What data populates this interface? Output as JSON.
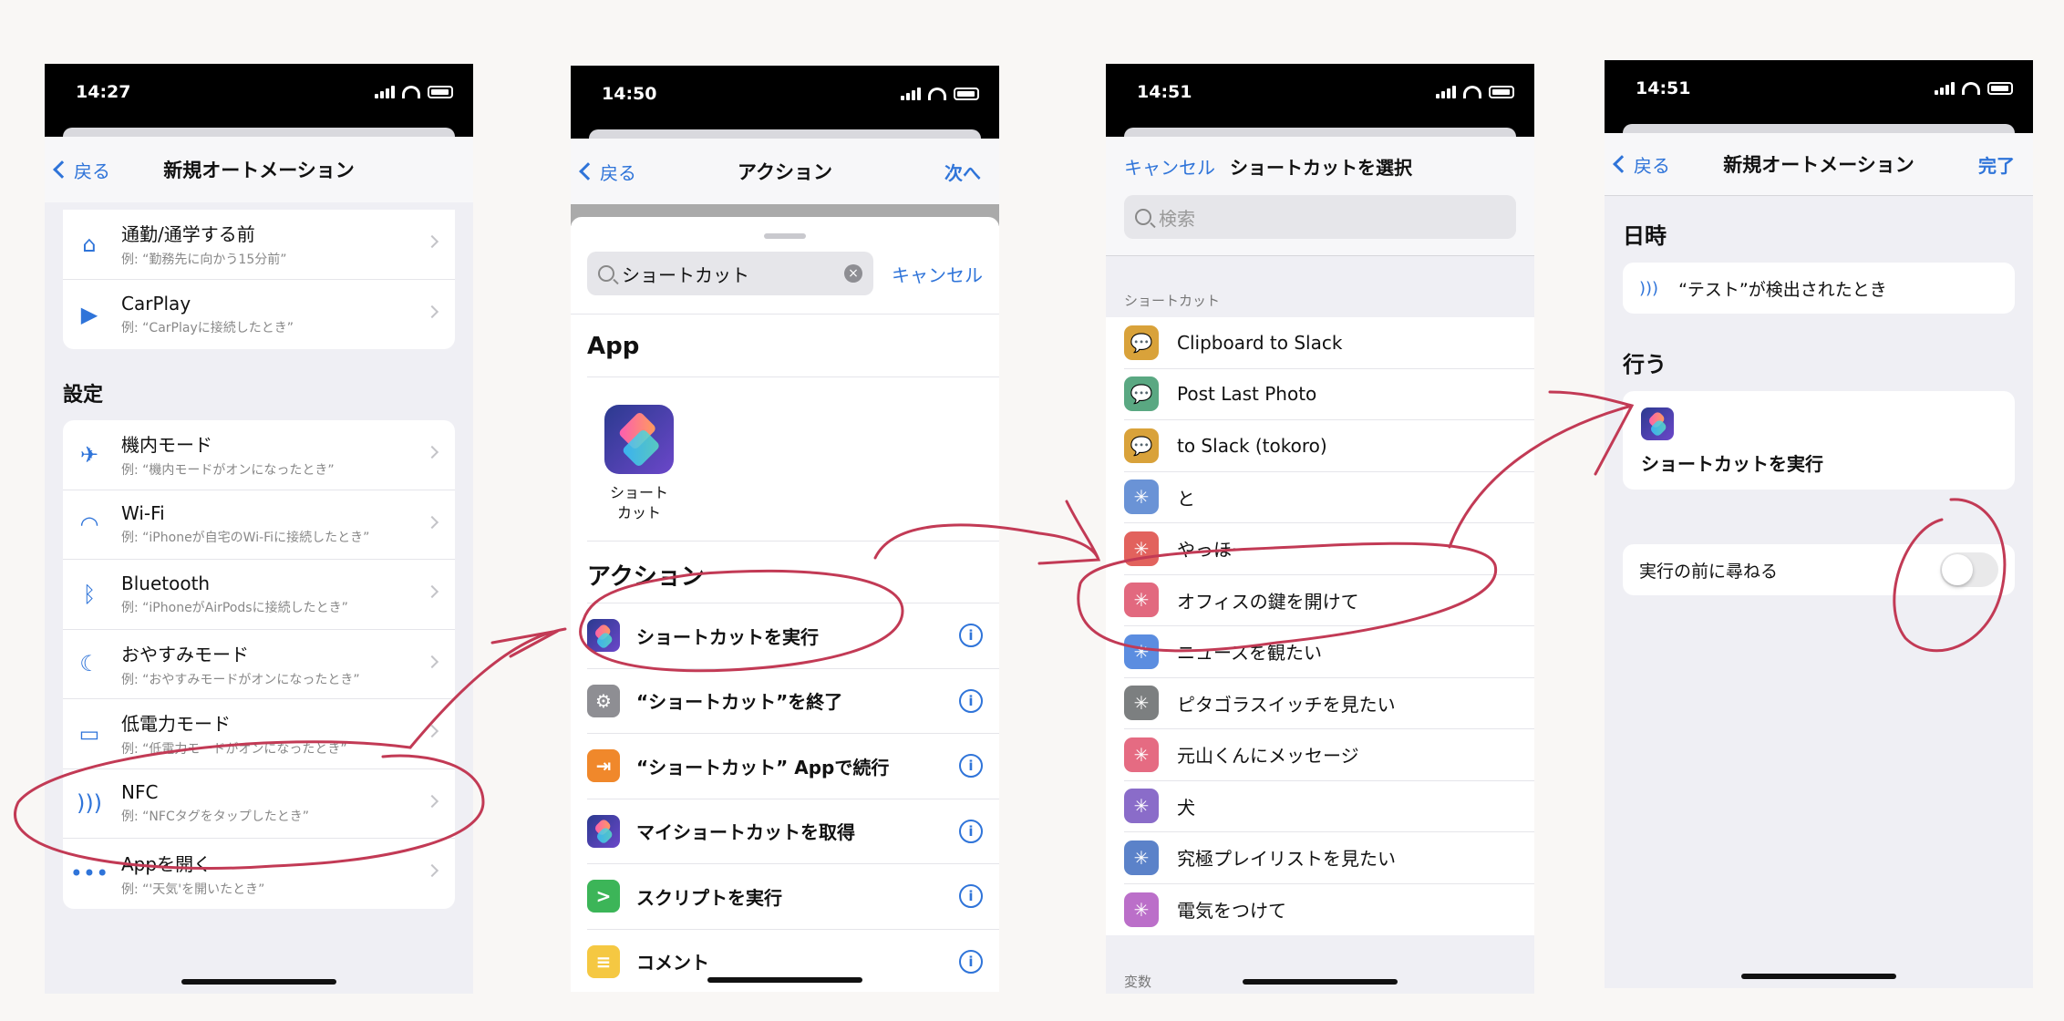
{
  "p1": {
    "time": "14:27",
    "back": "戻る",
    "title": "新規オートメーション",
    "items_top": [
      {
        "label": "通勤/通学する前",
        "sub": "例: “勤務先に向かう15分前”",
        "icon": "home-person-icon"
      },
      {
        "label": "CarPlay",
        "sub": "例: “CarPlayに接続したとき”",
        "icon": "carplay-icon"
      }
    ],
    "section": "設定",
    "items": [
      {
        "label": "機内モード",
        "sub": "例: “機内モードがオンになったとき”",
        "icon": "airplane-icon"
      },
      {
        "label": "Wi-Fi",
        "sub": "例: “iPhoneが自宅のWi-Fiに接続したとき”",
        "icon": "wifi-icon"
      },
      {
        "label": "Bluetooth",
        "sub": "例: “iPhoneがAirPodsに接続したとき”",
        "icon": "bluetooth-icon"
      },
      {
        "label": "おやすみモード",
        "sub": "例: “おやすみモードがオンになったとき”",
        "icon": "moon-icon"
      },
      {
        "label": "低電力モード",
        "sub": "例: “低電力モードがオンになったとき”",
        "icon": "battery-icon"
      },
      {
        "label": "NFC",
        "sub": "例: “NFCタグをタップしたとき”",
        "icon": "nfc-icon"
      },
      {
        "label": "Appを開く",
        "sub": "例: “'天気'を開いたとき”",
        "icon": "app-icon"
      }
    ]
  },
  "p2": {
    "time": "14:50",
    "back": "戻る",
    "title": "アクション",
    "next": "次へ",
    "search": "ショートカット",
    "cancel": "キャンセル",
    "app_header": "App",
    "app_name": "ショート\nカット",
    "actions_header": "アクション",
    "actions": [
      {
        "label": "ショートカットを実行",
        "color": "shortcuts"
      },
      {
        "label": "“ショートカット”を終了",
        "color": "#8e8e93"
      },
      {
        "label": "“ショートカット” Appで続行",
        "color": "#f0882b"
      },
      {
        "label": "マイショートカットを取得",
        "color": "shortcuts"
      },
      {
        "label": "スクリプトを実行",
        "color": "#3cb558"
      },
      {
        "label": "コメント",
        "color": "#f5c842"
      }
    ]
  },
  "p3": {
    "time": "14:51",
    "cancel": "キャンセル",
    "title": "ショートカットを選択",
    "search_placeholder": "検索",
    "section": "ショートカット",
    "footer": "変数",
    "items": [
      {
        "label": "Clipboard to Slack",
        "color": "#d9a23a",
        "icon": "speech-bubble-icon"
      },
      {
        "label": "Post Last Photo",
        "color": "#5aa882",
        "icon": "speech-bubble-icon"
      },
      {
        "label": "to Slack (tokoro)",
        "color": "#d9a23a",
        "icon": "speech-bubble-icon"
      },
      {
        "label": "と",
        "color": "#6a93d6",
        "icon": "sparkle-icon"
      },
      {
        "label": "やっほー",
        "color": "#e2625d",
        "icon": "sparkle-icon"
      },
      {
        "label": "オフィスの鍵を開けて",
        "color": "#e2697f",
        "icon": "sparkle-icon"
      },
      {
        "label": "ニュースを観たい",
        "color": "#5b8de0",
        "icon": "sparkle-icon"
      },
      {
        "label": "ピタゴラスイッチを見たい",
        "color": "#7c7f80",
        "icon": "sparkle-icon"
      },
      {
        "label": "元山くんにメッセージ",
        "color": "#e56b82",
        "icon": "sparkle-icon"
      },
      {
        "label": "犬",
        "color": "#8a6cc9",
        "icon": "sparkle-icon"
      },
      {
        "label": "究極プレイリストを見たい",
        "color": "#5b82c9",
        "icon": "sparkle-icon"
      },
      {
        "label": "電気をつけて",
        "color": "#bb6fc9",
        "icon": "sparkle-icon"
      }
    ]
  },
  "p4": {
    "time": "14:51",
    "back": "戻る",
    "title": "新規オートメーション",
    "done": "完了",
    "when_header": "日時",
    "trigger": "“テスト”が検出されたとき",
    "do_header": "行う",
    "action": "ショートカットを実行",
    "ask_label": "実行の前に尋ねる",
    "ask_on": false
  }
}
